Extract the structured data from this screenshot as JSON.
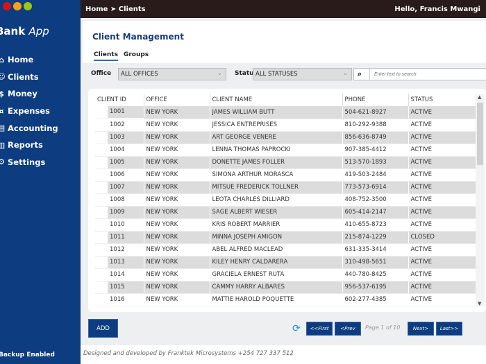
{
  "window": {
    "controls": [
      {
        "name": "close",
        "color": "#d7131a"
      },
      {
        "name": "minimize",
        "color": "#f5a214"
      },
      {
        "name": "maximize",
        "color": "#9bc612"
      }
    ]
  },
  "sidebar": {
    "brand": "Bank",
    "brand_suffix": "App",
    "items": [
      {
        "label": "Home",
        "icon": "home-icon",
        "glyph": "⌂"
      },
      {
        "label": "Clients",
        "icon": "user-icon",
        "glyph": "☺"
      },
      {
        "label": "Money",
        "icon": "money-bag-icon",
        "glyph": "$"
      },
      {
        "label": "Expenses",
        "icon": "expenses-icon",
        "glyph": "¤"
      },
      {
        "label": "Accounting",
        "icon": "ledger-icon",
        "glyph": "▤"
      },
      {
        "label": "Reports",
        "icon": "bar-chart-icon",
        "glyph": "▥"
      },
      {
        "label": "Settings",
        "icon": "gear-icon",
        "glyph": "⚙"
      }
    ],
    "footer": "Backup Enabled"
  },
  "topbar": {
    "breadcrumb": "Home ➤ Clients",
    "greeting": "Hello, Francis Mwangi"
  },
  "main": {
    "title": "Client Management",
    "tabs": [
      {
        "label": "Clients",
        "active": true
      },
      {
        "label": "Groups",
        "active": false
      }
    ],
    "filters": {
      "office_label": "Office",
      "office_value": "ALL OFFICES",
      "status_label": "Status",
      "status_value": "ALL STATUSES",
      "search_placeholder": "Enter text to search"
    },
    "table": {
      "columns": [
        "CLIENT ID",
        "OFFICE",
        "CLIENT NAME",
        "PHONE",
        "STATUS"
      ],
      "rows": [
        [
          "1001",
          "NEW YORK",
          "JAMES WILLIAM BUTT",
          "504-621-8927",
          "ACTIVE"
        ],
        [
          "1002",
          "NEW YORK",
          "JESSICA ENTREPRISES",
          "810-292-9388",
          "ACTIVE"
        ],
        [
          "1003",
          "NEW YORK",
          "ART GEORGE VENERE",
          "856-636-8749",
          "ACTIVE"
        ],
        [
          "1004",
          "NEW YORK",
          "LENNA THOMAS PAPROCKI",
          "907-385-4412",
          "ACTIVE"
        ],
        [
          "1005",
          "NEW YORK",
          "DONETTE JAMES FOLLER",
          "513-570-1893",
          "ACTIVE"
        ],
        [
          "1006",
          "NEW YORK",
          "SIMONA ARTHUR MORASCA",
          "419-503-2484",
          "ACTIVE"
        ],
        [
          "1007",
          "NEW YORK",
          "MITSUE FREDERICK TOLLNER",
          "773-573-6914",
          "ACTIVE"
        ],
        [
          "1008",
          "NEW YORK",
          "LEOTA CHARLES DILLIARD",
          "408-752-3500",
          "ACTIVE"
        ],
        [
          "1009",
          "NEW YORK",
          "SAGE ALBERT WIESER",
          "605-414-2147",
          "ACTIVE"
        ],
        [
          "1010",
          "NEW YORK",
          "KRIS ROBERT MARRIER",
          "410-655-8723",
          "ACTIVE"
        ],
        [
          "1011",
          "NEW YORK",
          "MINNA JOSEPH AMIGON",
          "215-874-1229",
          "CLOSED"
        ],
        [
          "1012",
          "NEW YORK",
          "ABEL ALFRED MACLEAD",
          "631-335-3414",
          "ACTIVE"
        ],
        [
          "1013",
          "NEW YORK",
          "KILEY HENRY CALDARERA",
          "310-498-5651",
          "ACTIVE"
        ],
        [
          "1014",
          "NEW YORK",
          "GRACIELA ERNEST RUTA",
          "440-780-8425",
          "ACTIVE"
        ],
        [
          "1015",
          "NEW YORK",
          "CAMMY HARRY ALBARES",
          "956-537-6195",
          "ACTIVE"
        ],
        [
          "1016",
          "NEW YORK",
          "MATTIE HAROLD POQUETTE",
          "602-277-4385",
          "ACTIVE"
        ]
      ]
    },
    "actions": {
      "add": "ADD",
      "first": "<<First",
      "prev": "<Prev",
      "page_info": "Page 1 of 10",
      "next": "Next>",
      "last": "Last>>"
    }
  },
  "credit": "Designed and developed by Franktek Microsystems +254 727 337 512"
}
